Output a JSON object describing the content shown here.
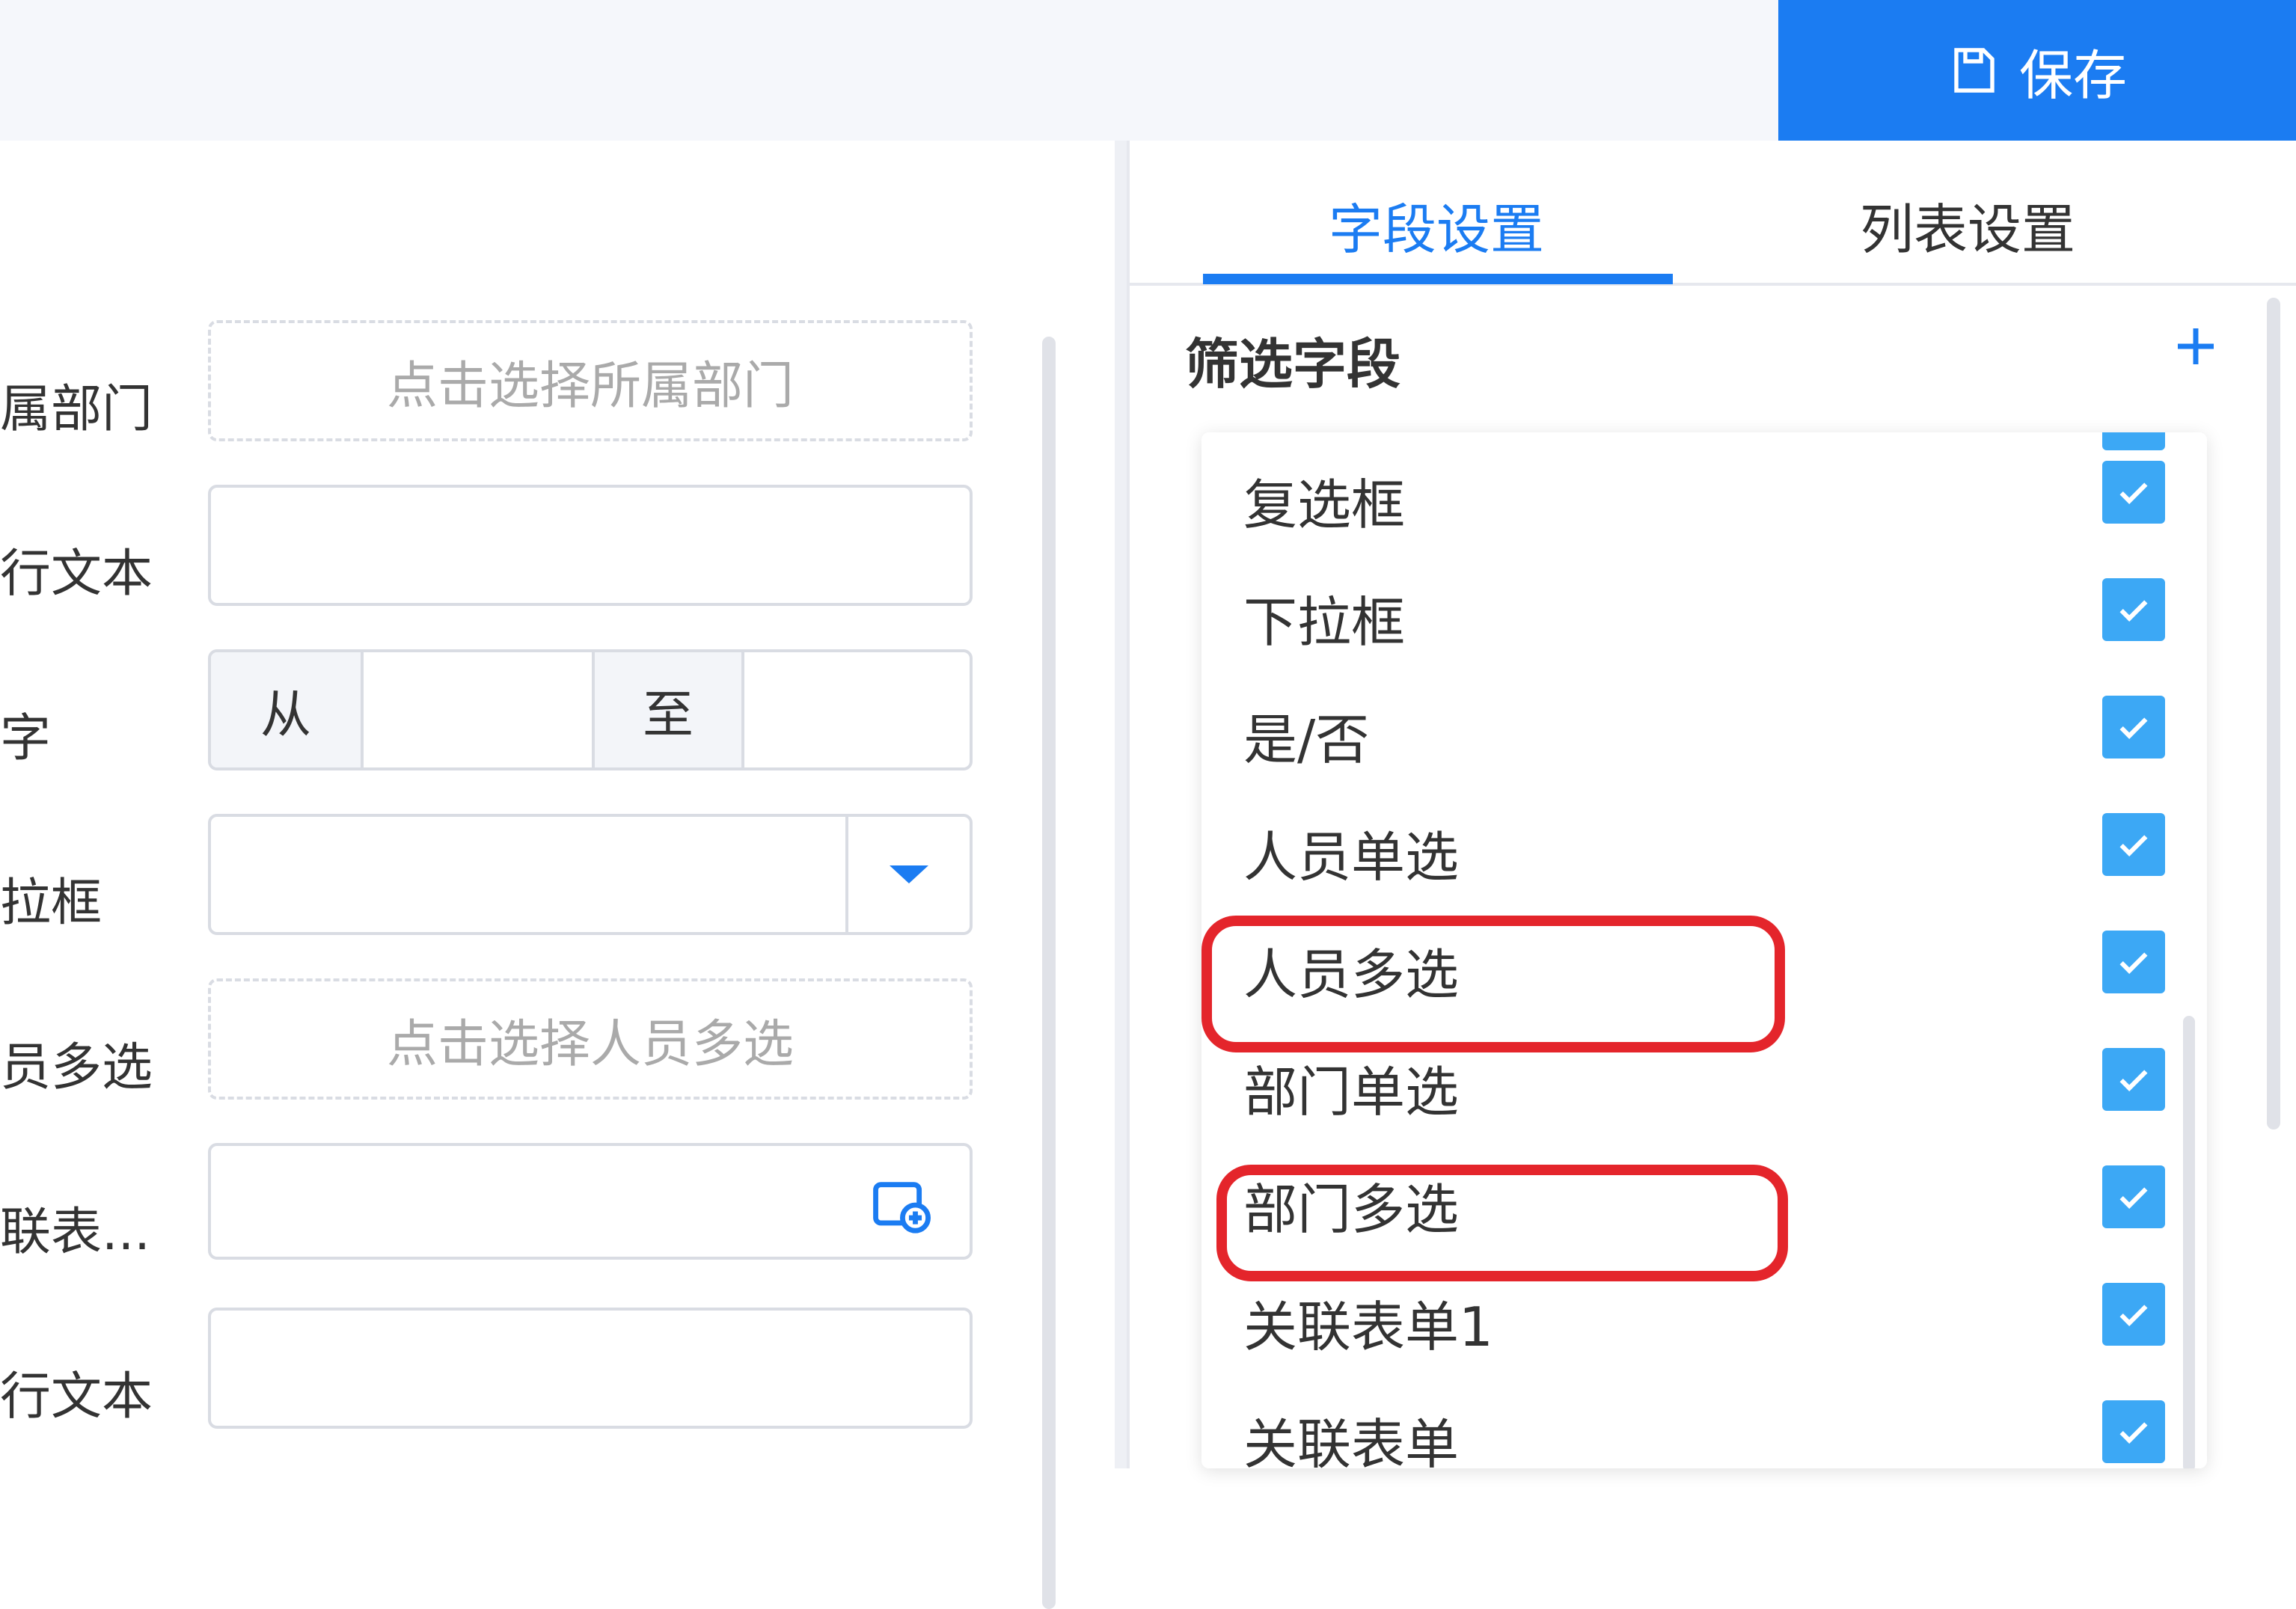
{
  "toolbar": {
    "save_label": "保存",
    "save_icon": "save-icon",
    "accent": "#1b7cf2"
  },
  "form": {
    "rows": [
      {
        "label": "属部门",
        "placeholder": "点击选择所属部门"
      },
      {
        "label": "行文本",
        "placeholder": ""
      },
      {
        "label": "字",
        "from_label": "从",
        "to_label": "至"
      },
      {
        "label": "拉框",
        "value": ""
      },
      {
        "label": "员多选",
        "placeholder": "点击选择人员多选"
      },
      {
        "label": "联表...",
        "value": ""
      },
      {
        "label": "行文本",
        "placeholder": ""
      }
    ]
  },
  "panel": {
    "tabs": [
      {
        "label": "字段设置",
        "active": true
      },
      {
        "label": "列表设置",
        "active": false
      }
    ],
    "section_title": "筛选字段",
    "add_icon": "plus-icon",
    "filter_fields": [
      {
        "label": "复选框",
        "checked": true
      },
      {
        "label": "下拉框",
        "checked": true
      },
      {
        "label": "是/否",
        "checked": true
      },
      {
        "label": "人员单选",
        "checked": true
      },
      {
        "label": "人员多选",
        "checked": true,
        "highlighted": true
      },
      {
        "label": "部门单选",
        "checked": true
      },
      {
        "label": "部门多选",
        "checked": true,
        "highlighted": true
      },
      {
        "label": "关联表单1",
        "checked": true
      },
      {
        "label": "关联表单",
        "checked": true
      }
    ],
    "checkbox_color": "#3ca8f5",
    "highlight_color": "#e4252b"
  }
}
